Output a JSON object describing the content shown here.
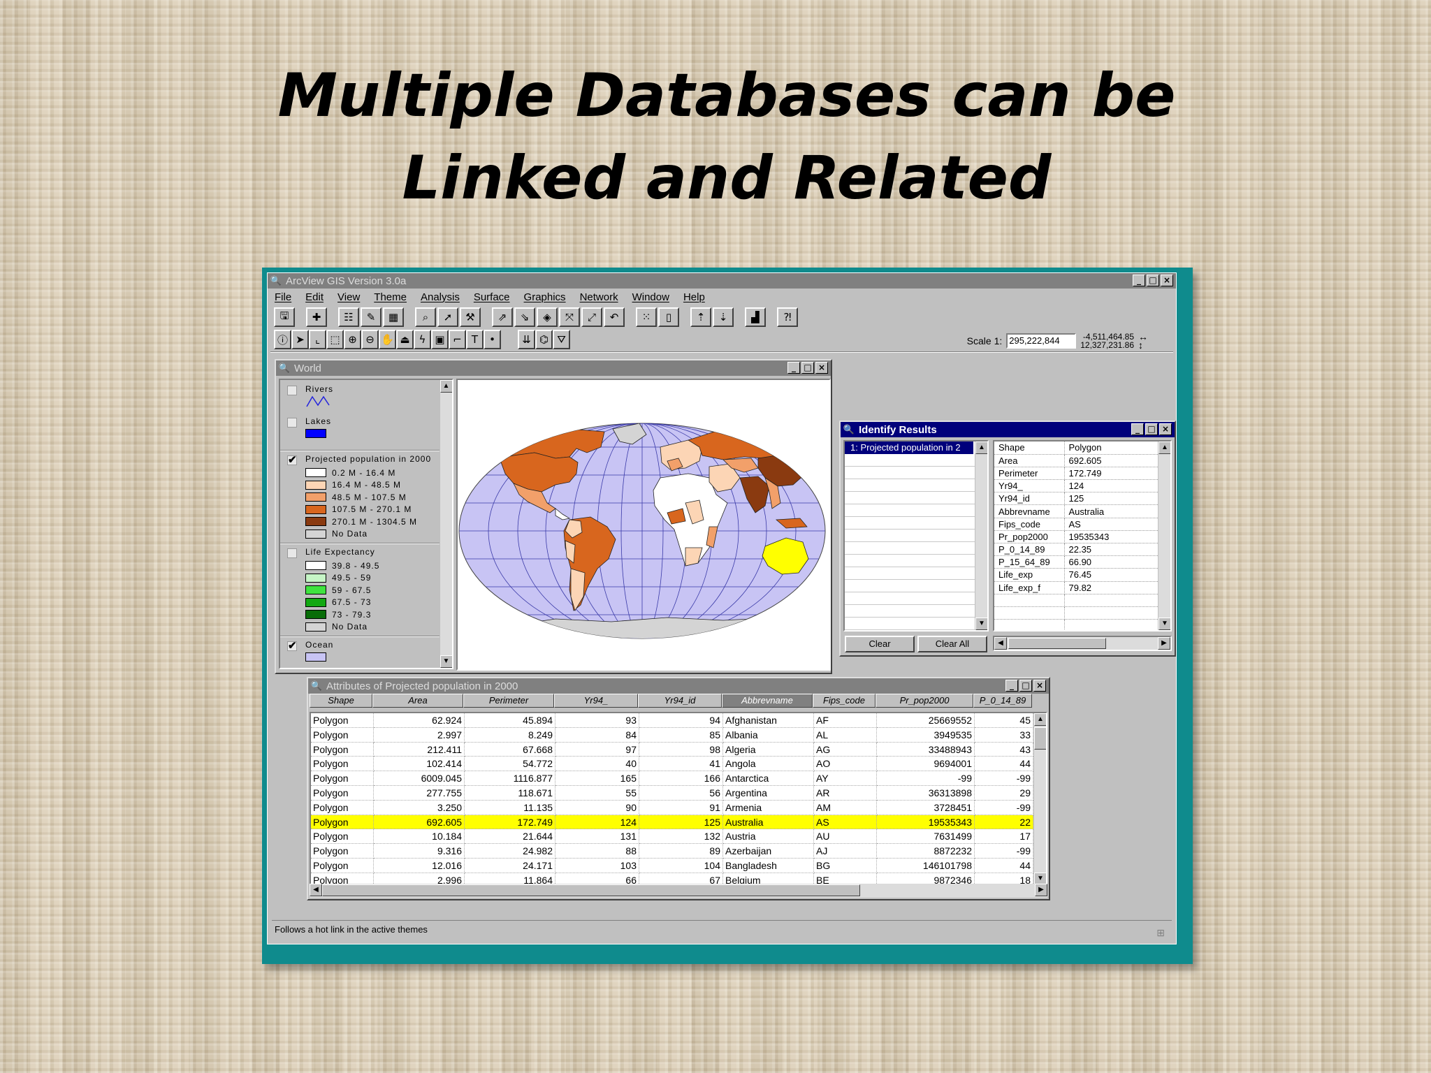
{
  "slide": {
    "title_line1": "Multiple Databases can be",
    "title_line2": "Linked and Related"
  },
  "app": {
    "title": "ArcView GIS Version 3.0a",
    "menu": [
      "File",
      "Edit",
      "View",
      "Theme",
      "Analysis",
      "Surface",
      "Graphics",
      "Network",
      "Window",
      "Help"
    ],
    "scale_label": "Scale 1:",
    "scale_value": "295,222,844",
    "coord_x": "-4,511,464.85",
    "coord_y": "12,327,231.86",
    "status": "Follows a hot link in the active themes"
  },
  "world": {
    "title": "World",
    "themes": {
      "rivers": "Rivers",
      "lakes": "Lakes",
      "population": "Projected population in 2000",
      "life": "Life Expectancy",
      "ocean": "Ocean"
    },
    "population_classes": [
      {
        "label": "0.2 M - 16.4 M",
        "color": "#ffffff"
      },
      {
        "label": "16.4 M - 48.5 M",
        "color": "#fcd5b5"
      },
      {
        "label": "48.5 M - 107.5 M",
        "color": "#f2a06a"
      },
      {
        "label": "107.5 M - 270.1 M",
        "color": "#d8661e"
      },
      {
        "label": "270.1 M - 1304.5 M",
        "color": "#8a3a10"
      },
      {
        "label": "No Data",
        "color": "#d4d4d4"
      }
    ],
    "life_classes": [
      {
        "label": "39.8 - 49.5",
        "color": "#ffffff"
      },
      {
        "label": "49.5 - 59",
        "color": "#c6f5c6"
      },
      {
        "label": "59 - 67.5",
        "color": "#3fe33f"
      },
      {
        "label": "67.5 - 73",
        "color": "#12a812"
      },
      {
        "label": "73 - 79.3",
        "color": "#086d08"
      },
      {
        "label": "No Data",
        "color": "#d4d4d4"
      }
    ],
    "colors": {
      "ocean": "#c8c4f4",
      "lakes": "#0000ff",
      "highlight": "#ffff00"
    }
  },
  "identify": {
    "title": "Identify Results",
    "list_item": "1:  Projected population in 2",
    "clear": "Clear",
    "clear_all": "Clear All",
    "fields": [
      [
        "Shape",
        "Polygon"
      ],
      [
        "Area",
        "692.605"
      ],
      [
        "Perimeter",
        "172.749"
      ],
      [
        "Yr94_",
        "124"
      ],
      [
        "Yr94_id",
        "125"
      ],
      [
        "Abbrevname",
        "Australia"
      ],
      [
        "Fips_code",
        "AS"
      ],
      [
        "Pr_pop2000",
        "19535343"
      ],
      [
        "P_0_14_89",
        "22.35"
      ],
      [
        "P_15_64_89",
        "66.90"
      ],
      [
        "Life_exp",
        "76.45"
      ],
      [
        "Life_exp_f",
        "79.82"
      ]
    ]
  },
  "attributes": {
    "title": "Attributes of Projected population in 2000",
    "columns": [
      "Shape",
      "Area",
      "Perimeter",
      "Yr94_",
      "Yr94_id",
      "Abbrevname",
      "Fips_code",
      "Pr_pop2000",
      "P_0_14_89"
    ],
    "selected_column": "Abbrevname",
    "highlighted_row": "Australia",
    "rows": [
      [
        "Polygon",
        "62.924",
        "45.894",
        "93",
        "94",
        "Afghanistan",
        "AF",
        "25669552",
        "45"
      ],
      [
        "Polygon",
        "2.997",
        "8.249",
        "84",
        "85",
        "Albania",
        "AL",
        "3949535",
        "33"
      ],
      [
        "Polygon",
        "212.411",
        "67.668",
        "97",
        "98",
        "Algeria",
        "AG",
        "33488943",
        "43"
      ],
      [
        "Polygon",
        "102.414",
        "54.772",
        "40",
        "41",
        "Angola",
        "AO",
        "9694001",
        "44"
      ],
      [
        "Polygon",
        "6009.045",
        "1116.877",
        "165",
        "166",
        "Antarctica",
        "AY",
        "-99",
        "-99"
      ],
      [
        "Polygon",
        "277.755",
        "118.671",
        "55",
        "56",
        "Argentina",
        "AR",
        "36313898",
        "29"
      ],
      [
        "Polygon",
        "3.250",
        "11.135",
        "90",
        "91",
        "Armenia",
        "AM",
        "3728451",
        "-99"
      ],
      [
        "Polygon",
        "692.605",
        "172.749",
        "124",
        "125",
        "Australia",
        "AS",
        "19535343",
        "22"
      ],
      [
        "Polygon",
        "10.184",
        "21.644",
        "131",
        "132",
        "Austria",
        "AU",
        "7631499",
        "17"
      ],
      [
        "Polygon",
        "9.316",
        "24.982",
        "88",
        "89",
        "Azerbaijan",
        "AJ",
        "8872232",
        "-99"
      ],
      [
        "Polygon",
        "12.016",
        "24.171",
        "103",
        "104",
        "Bangladesh",
        "BG",
        "146101798",
        "44"
      ],
      [
        "Polygon",
        "2.996",
        "11.864",
        "66",
        "67",
        "Belgium",
        "BE",
        "9872346",
        "18"
      ]
    ]
  }
}
